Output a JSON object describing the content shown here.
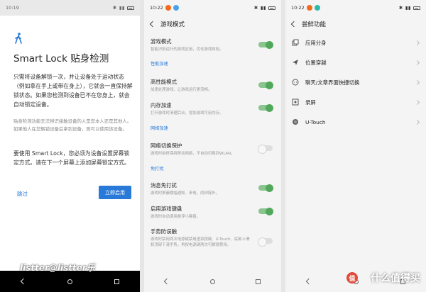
{
  "panel1": {
    "status": {
      "time": "10:19"
    },
    "title": "Smart Lock 贴身检测",
    "main_text": "只需将设备解锁一次，并让设备处于运动状态（例如拿在手上或带在身上），它就会一直保持解锁状态。如果您检测到设备已不在您身上，就会自动锁定设备。",
    "sub_text": "贴身检测功能无法辨识接触设备的人是您本人还是其他人。如果他人在您解锁设备后拿到设备，则可以使用该设备。",
    "requirement_text": "要使用 Smart Lock，您必须为设备设置屏幕锁定方式。请在下一个屏幕上添加屏幕锁定方式。",
    "skip_label": "跳过",
    "enable_label": "立即启用"
  },
  "panel2": {
    "status": {
      "time": "10:22"
    },
    "header": "游戏模式",
    "items": [
      {
        "title": "游戏模式",
        "desc": "智能识别运行的游戏应用，优化游戏体验。",
        "on": true
      },
      {
        "title": "高性能模式",
        "desc": "加速处理游戏，让游戏运行更流畅。",
        "on": true
      },
      {
        "title": "内存加速",
        "desc": "打开游戏时清理后台，增加游戏可用内存。",
        "on": true
      },
      {
        "title": "网络切换保护",
        "desc": "游戏时始终保持移动网络，不自动切换到WLAN。",
        "on": false
      },
      {
        "title": "消息免打扰",
        "desc": "游戏时屏蔽横幅通知、来电、闹钟除外。",
        "on": true
      },
      {
        "title": "启用游戏键盘",
        "desc": "游戏时自动调用悬浮小键盘。",
        "on": true
      },
      {
        "title": "手势防误触",
        "desc": "游戏时禁用两次电源键禁用虚拟按键、U-Touch、底部上滑和顶部下滑手势，再按电源键两次可解锁禁用。",
        "on": false
      }
    ],
    "sections": [
      "性能加速",
      "网络加速",
      "免打扰"
    ]
  },
  "panel3": {
    "status": {
      "time": "10:22"
    },
    "header": "尝鲜功能",
    "items": [
      {
        "label": "应用分身",
        "icon": "app-clone-icon"
      },
      {
        "label": "位置穿越",
        "icon": "location-icon"
      },
      {
        "label": "聊天/文章界面快捷切换",
        "icon": "chat-switch-icon"
      },
      {
        "label": "录屏",
        "icon": "screen-record-icon"
      },
      {
        "label": "U-Touch",
        "icon": "utouch-icon"
      }
    ]
  },
  "watermark": {
    "author": "listter@listter乐",
    "site": "什么值得买",
    "badge": "值"
  },
  "colors": {
    "accent": "#2979d9",
    "toggle_on": "#52a85a",
    "background": "#f4f4f4"
  }
}
